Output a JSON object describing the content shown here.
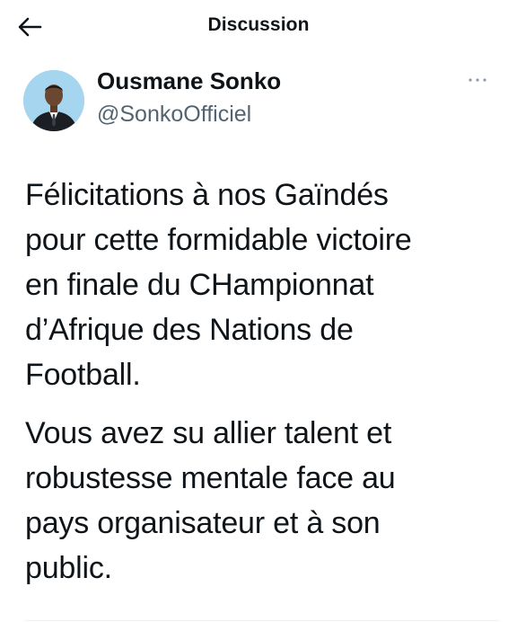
{
  "header": {
    "title": "Discussion",
    "back_icon": "arrow-left-icon"
  },
  "tweet": {
    "author": {
      "name": "Ousmane Sonko",
      "handle": "@SonkoOfficiel",
      "avatar_icon": "profile-photo"
    },
    "more_icon": "more-dots-icon",
    "paragraphs": [
      "Félicitations à nos Gaïndés\npour cette formidable victoire\nen finale du CHampionnat\nd’Afrique des Nations de\nFootball.",
      "Vous avez su allier talent et\nrobustesse mentale face au\npays organisateur et à son\npublic."
    ]
  },
  "colors": {
    "text": "#0f1419",
    "secondary": "#536471",
    "divider": "#eff3f4",
    "avatar_background": "#a6d6ef"
  }
}
